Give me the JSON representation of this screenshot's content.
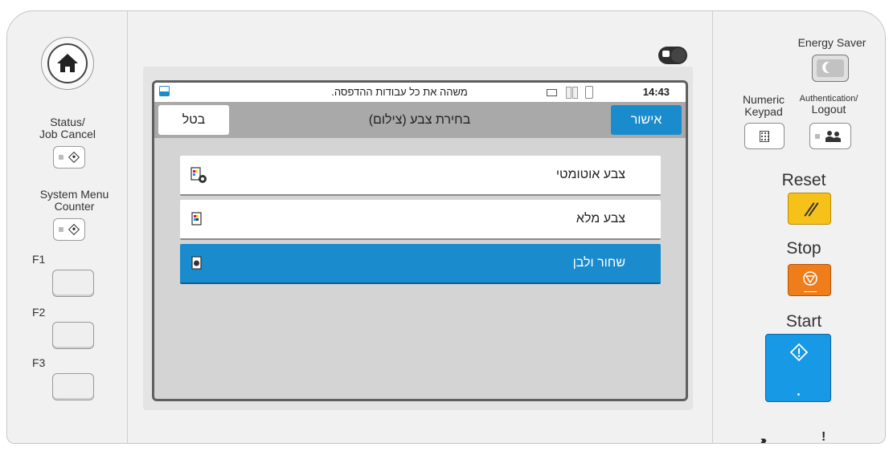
{
  "left_panel": {
    "status_label_1": "Status/",
    "status_label_2": "Job Cancel",
    "system_label_1": "System Menu",
    "system_label_2": "Counter",
    "f1_label": "F1",
    "f2_label": "F2",
    "f3_label": "F3"
  },
  "screen": {
    "status_message": "משהה את כל עבודות ההדפסה.",
    "time": "14:43",
    "title": "בחירת צבע (צילום)",
    "cancel_label": "בטל",
    "ok_label": "אישור",
    "options": [
      {
        "label": "צבע אוטומטי",
        "icon": "auto-color-icon",
        "selected": false
      },
      {
        "label": "צבע מלא",
        "icon": "full-color-icon",
        "selected": false
      },
      {
        "label": "שחור ולבן",
        "icon": "black-white-icon",
        "selected": true
      }
    ]
  },
  "right_panel": {
    "energy_saver_label": "Energy Saver",
    "numeric_label_1": "Numeric",
    "numeric_label_2": "Keypad",
    "auth_label_1": "Authentication/",
    "auth_label_2": "Logout",
    "reset_label": "Reset",
    "stop_label": "Stop",
    "start_label": "Start",
    "bottom_indicator": "!"
  },
  "colors": {
    "accent_blue": "#1a8ccd",
    "reset_yellow": "#f6c21a",
    "stop_orange": "#ef7d1a",
    "start_blue": "#1899e6"
  }
}
